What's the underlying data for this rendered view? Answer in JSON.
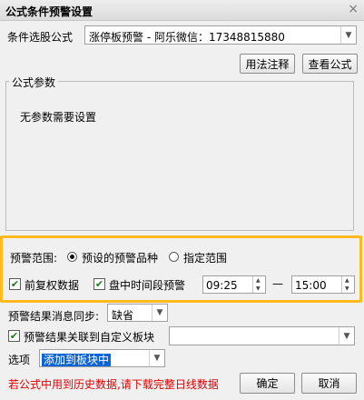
{
  "window": {
    "title": "公式条件预警设置",
    "close": "×"
  },
  "formula": {
    "label": "条件选股公式",
    "value": "涨停板预警  -  阿乐微信：17348815880",
    "usage_button": "用法注释",
    "view_button": "查看公式"
  },
  "params": {
    "legend": "公式参数",
    "empty_text": "无参数需要设置"
  },
  "range": {
    "label": "预警范围:",
    "option_preset": "预设的预警品种",
    "option_custom": "指定范围",
    "selected": "预设的预警品种"
  },
  "options": {
    "adjusted_label": "前复权数据",
    "adjusted_checked": true,
    "timed_label": "盘中时间段预警",
    "timed_checked": true,
    "start_time": "09:25",
    "dash": "—",
    "end_time": "15:00"
  },
  "sync": {
    "label": "预警结果消息同步:",
    "value": "缺省"
  },
  "link": {
    "label": "预警结果关联到自定义板块",
    "checked": true,
    "value": ""
  },
  "option_row": {
    "label": "选项",
    "value": "添加到板块中"
  },
  "footer": {
    "warning": "若公式中用到历史数据,请下载完整日线数据",
    "ok_button": "确定",
    "cancel_button": "取消"
  },
  "colors": {
    "highlight": "#ffbb1e",
    "warning": "#e00000",
    "selection": "#0a64d8"
  }
}
